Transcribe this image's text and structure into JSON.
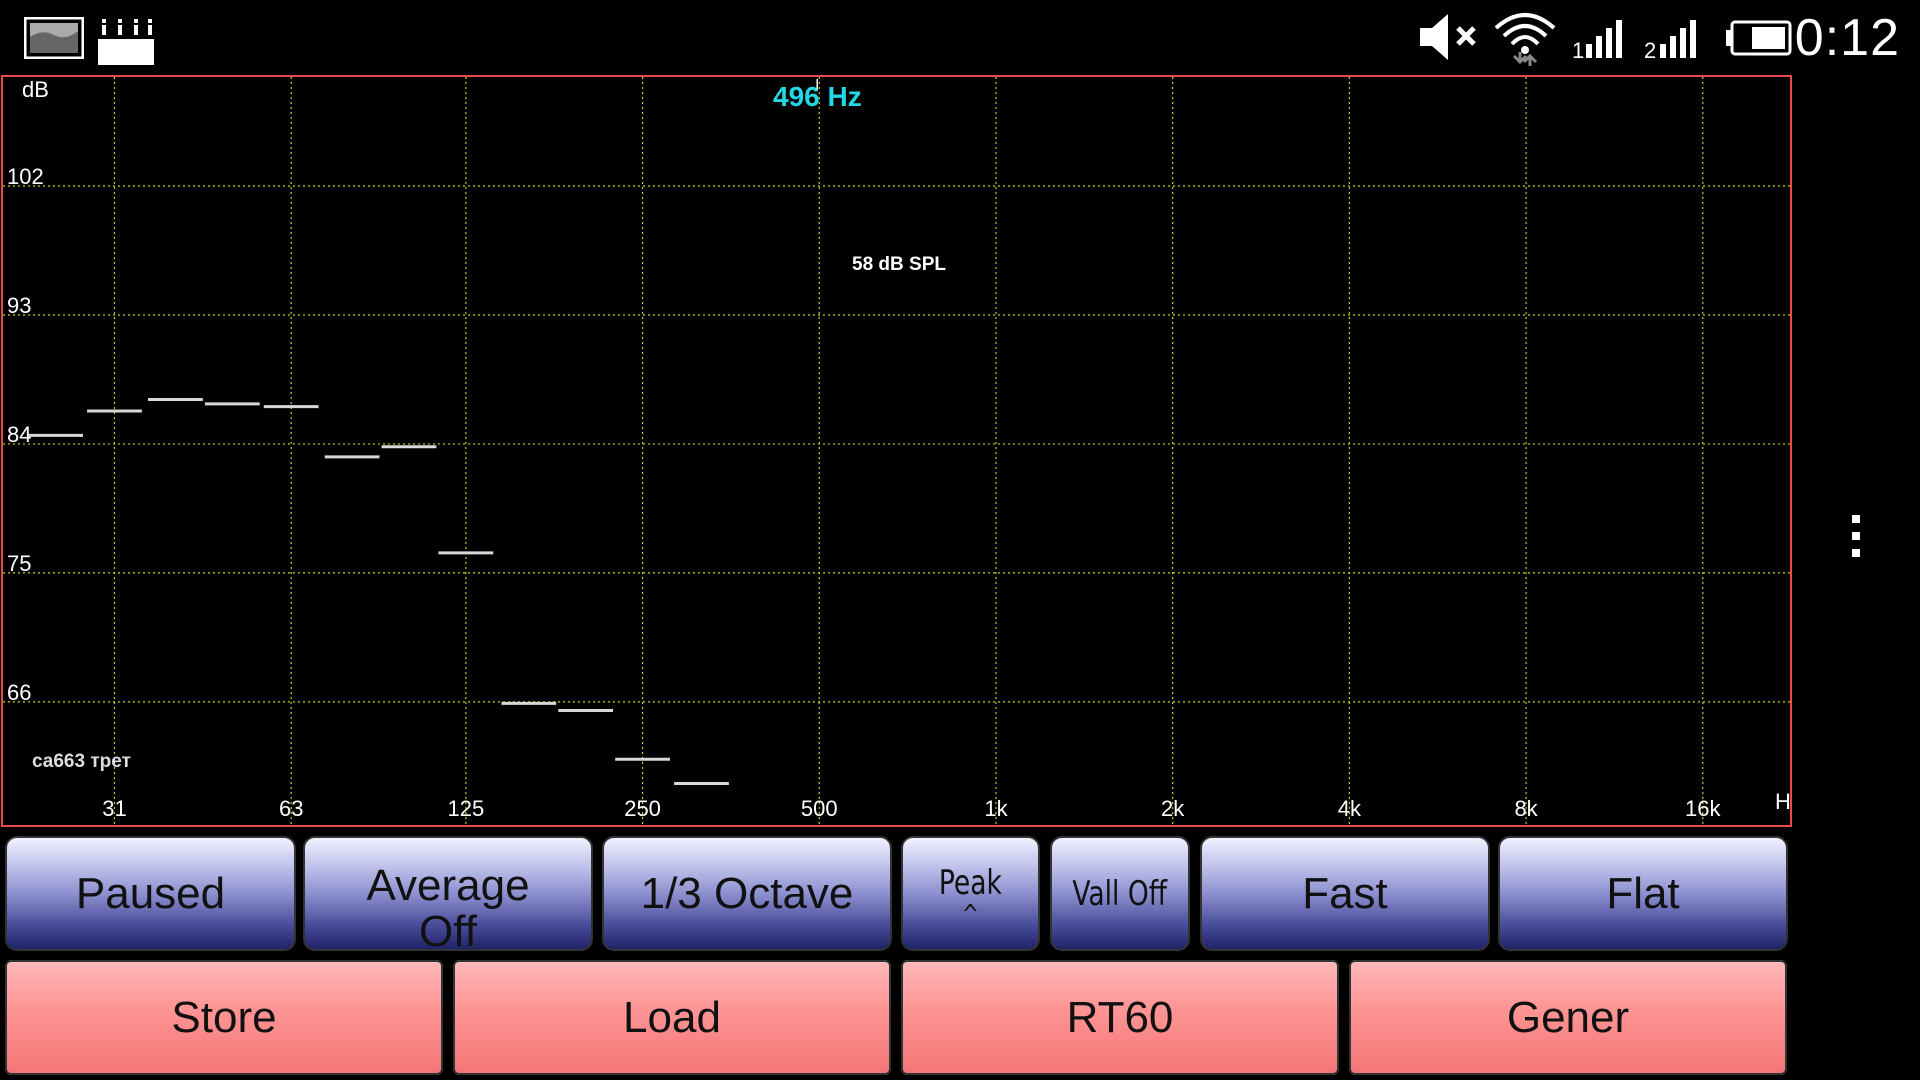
{
  "status_bar": {
    "time": "0:12",
    "icons": [
      "spectrum-app-icon",
      "bars-app-icon",
      "mute-icon",
      "wifi-icon",
      "signal-1-icon",
      "signal-2-icon",
      "battery-icon"
    ]
  },
  "plot": {
    "frequency_readout": "496 Hz",
    "spl_readout": "58 dB SPL",
    "note": "са663 трет",
    "y_unit": "dB",
    "x_unit": "H",
    "y_ticks": [
      "102",
      "93",
      "84",
      "75",
      "66"
    ],
    "x_ticks": [
      "31",
      "63",
      "125",
      "250",
      "500",
      "1k",
      "2k",
      "4k",
      "8k",
      "16k"
    ],
    "colors": {
      "border": "#e84a4a",
      "grid": "#cccc22",
      "readout": "#22d8e6",
      "bars": "#d8d8d8"
    }
  },
  "chart_data": {
    "type": "bar",
    "title": "",
    "xlabel": "H",
    "ylabel": "dB",
    "x_scale": "log",
    "ylim": [
      58,
      109
    ],
    "grid": true,
    "series": [
      {
        "values": [
          {
            "hz": 25,
            "db": 84.6
          },
          {
            "hz": 31.5,
            "db": 86.3
          },
          {
            "hz": 40,
            "db": 87.1
          },
          {
            "hz": 50,
            "db": 86.8
          },
          {
            "hz": 63,
            "db": 86.6
          },
          {
            "hz": 80,
            "db": 83.1
          },
          {
            "hz": 100,
            "db": 83.8
          },
          {
            "hz": 125,
            "db": 76.4
          },
          {
            "hz": 160,
            "db": 65.9
          },
          {
            "hz": 200,
            "db": 65.4
          },
          {
            "hz": 250,
            "db": 62.0
          },
          {
            "hz": 315,
            "db": 60.3
          }
        ]
      }
    ]
  },
  "controls": {
    "row1": [
      {
        "label": "Paused",
        "name": "paused-button"
      },
      {
        "label": "Average",
        "label2": "Off",
        "name": "average-button"
      },
      {
        "label": "1/3 Octave",
        "name": "octave-button"
      },
      {
        "label": "Peak",
        "label2": "^",
        "name": "peak-button"
      },
      {
        "label": "Vall Off",
        "name": "valley-button"
      },
      {
        "label": "Fast",
        "name": "fast-button"
      },
      {
        "label": "Flat",
        "name": "flat-button"
      }
    ],
    "row2": [
      {
        "label": "Store",
        "name": "store-button"
      },
      {
        "label": "Load",
        "name": "load-button"
      },
      {
        "label": "RT60",
        "name": "rt60-button"
      },
      {
        "label": "Gener",
        "name": "generator-button"
      }
    ]
  }
}
